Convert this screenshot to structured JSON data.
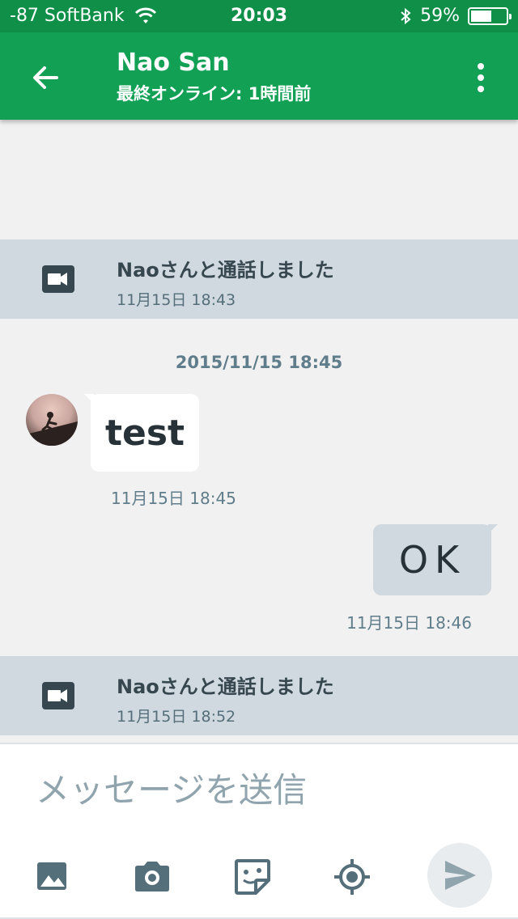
{
  "status_bar": {
    "carrier": "-87 SoftBank",
    "time": "20:03",
    "battery": "59%",
    "battery_level": 0.59
  },
  "header": {
    "title": "Nao San",
    "subtitle": "最終オンライン: 1時間前"
  },
  "chat": {
    "events": [
      {
        "title": "Naoさんと通話しました",
        "time": "11月15日 18:43"
      },
      {
        "title": "Naoさんと通話しました",
        "time": "11月15日 18:52"
      }
    ],
    "date_separator": "2015/11/15 18:45",
    "incoming": {
      "text": "test",
      "time": "11月15日 18:45"
    },
    "outgoing": {
      "text": "OK",
      "time": "11月15日 18:46"
    }
  },
  "composer": {
    "placeholder": "メッセージを送信"
  },
  "colors": {
    "status_bar": "#0f8f47",
    "app_bar": "#12a055",
    "event_row": "#d0d9df",
    "icon": "#546e7a"
  },
  "icons": {
    "back": "arrow-left-icon",
    "more": "more-vert-icon",
    "call": "video-camera-icon",
    "image": "image-icon",
    "camera": "camera-icon",
    "sticker": "sticker-icon",
    "location": "location-icon",
    "send": "send-icon"
  }
}
